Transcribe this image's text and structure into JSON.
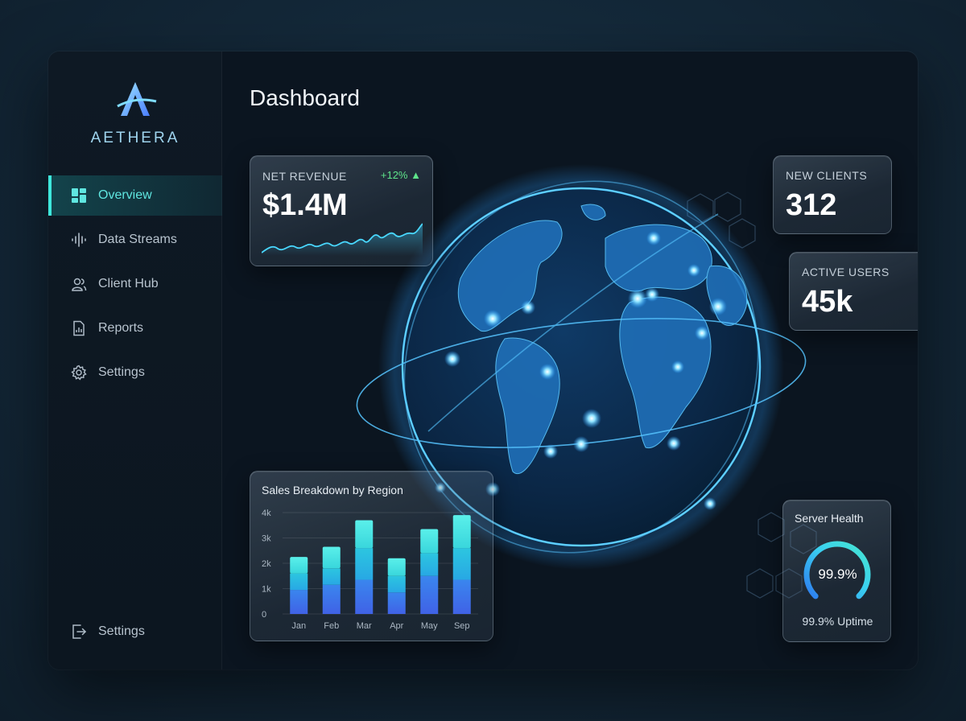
{
  "brand": {
    "name": "AETHERA"
  },
  "sidebar": {
    "items": [
      {
        "label": "Overview",
        "icon": "grid-icon",
        "active": true
      },
      {
        "label": "Data Streams",
        "icon": "waveform-icon",
        "active": false
      },
      {
        "label": "Client Hub",
        "icon": "users-icon",
        "active": false
      },
      {
        "label": "Reports",
        "icon": "report-icon",
        "active": false
      },
      {
        "label": "Settings",
        "icon": "gear-icon",
        "active": false
      }
    ],
    "bottom": {
      "label": "Settings",
      "icon": "logout-icon"
    }
  },
  "page": {
    "title": "Dashboard"
  },
  "revenue": {
    "label": "NET REVENUE",
    "value": "$1.4M",
    "delta": "+12%"
  },
  "new_clients": {
    "label": "NEW CLIENTS",
    "value": "312"
  },
  "active_users": {
    "label": "ACTIVE USERS",
    "value": "45k"
  },
  "server_health": {
    "title": "Server Health",
    "value": "99.9%",
    "uptime": "99.9% Uptime",
    "level": 0.999
  },
  "colors": {
    "accent": "#3ee8dc",
    "positive": "#5ee38a",
    "bar_top": "#43e8e0",
    "bar_bottom": "#3f6ee8",
    "globe": "#2fa8ff"
  },
  "chart_data": {
    "type": "bar",
    "title": "Sales Breakdown by Region",
    "categories": [
      "Jan",
      "Feb",
      "Mar",
      "Apr",
      "May",
      "Sep"
    ],
    "y_ticks": [
      "0",
      "1k",
      "2k",
      "3k",
      "4k"
    ],
    "ylim": [
      0,
      4000
    ],
    "series": [
      {
        "values": [
          950,
          1150,
          1350,
          850,
          1500,
          1350
        ]
      },
      {
        "values": [
          650,
          650,
          1250,
          650,
          900,
          1250
        ]
      },
      {
        "values": [
          650,
          850,
          1100,
          700,
          950,
          1300
        ]
      }
    ],
    "totals": [
      2250,
      2650,
      3700,
      2200,
      3350,
      3900
    ]
  }
}
